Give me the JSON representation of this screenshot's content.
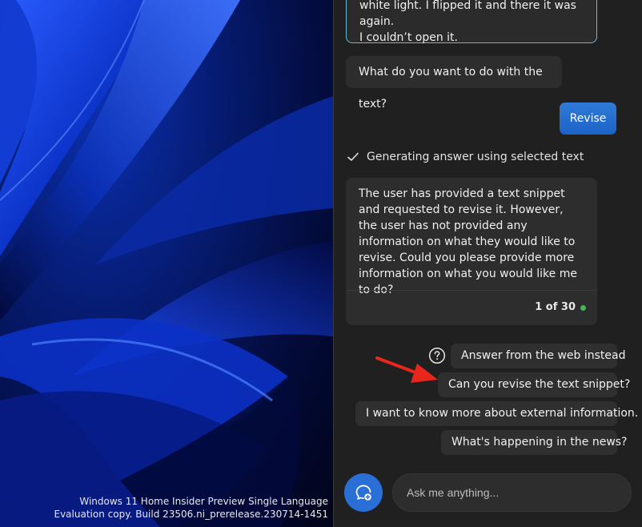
{
  "desktop": {
    "watermark_line1": "Windows 11 Home Insider Preview Single Language",
    "watermark_line2": "Evaluation copy. Build 23506.ni_prerelease.230714-1451"
  },
  "chat": {
    "user_quote_line1": "white light. I flipped it and there it was again.",
    "user_quote_line2": "I couldn’t open it.",
    "assistant_question": "What do you want to do with the text?",
    "revise_button": "Revise",
    "status": "Generating answer using selected text",
    "answer": "The user has provided a text snippet and requested to revise it. However, the user has not provided any information on what they would like to revise. Could you please provide more information on what you would like me to do?",
    "turn_count": "1 of 30"
  },
  "suggestions": {
    "web": "Answer from the web instead",
    "revise": "Can you revise the text snippet?",
    "external": "I want to know more about external information.",
    "news": "What's happening in the news?"
  },
  "input": {
    "placeholder": "Ask me anything..."
  },
  "icons": {
    "help": "question-circle-icon",
    "compose": "new-topic-icon",
    "status": "checkmark-icon",
    "annotation": "red-arrow-icon"
  },
  "colors": {
    "accent": "#2a6fd6",
    "status_dot": "#3fb950",
    "annotation_arrow": "#e8261c"
  }
}
